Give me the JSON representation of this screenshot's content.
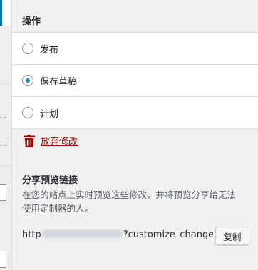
{
  "panel": {
    "title": "操作",
    "options": [
      {
        "label": "发布",
        "checked": false
      },
      {
        "label": "保存草稿",
        "checked": true
      },
      {
        "label": "计划",
        "checked": false
      }
    ],
    "discard_label": "放弃修改"
  },
  "share": {
    "title": "分享预览链接",
    "description": "在您的站点上实时预览这些修改，并将预览分享给无法使用定制器的人。",
    "link_prefix": "http",
    "link_suffix": "?customize_change",
    "copy_label": "复制"
  },
  "colors": {
    "accent": "#0073aa",
    "radio_checked": "#1e8cbe",
    "danger": "#aa0000"
  },
  "icons": {
    "discard": "trash-icon"
  }
}
